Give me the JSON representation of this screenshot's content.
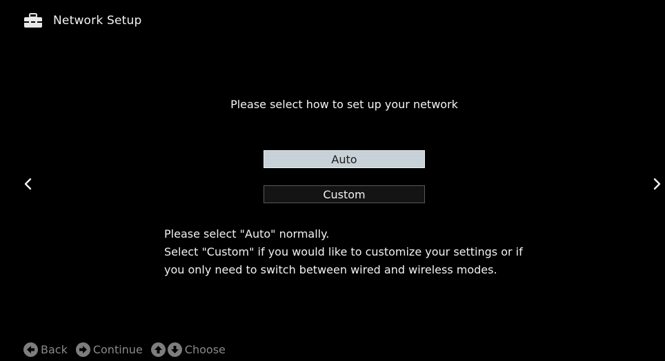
{
  "header": {
    "icon": "toolbox-icon",
    "title": "Network Setup"
  },
  "main": {
    "prompt": "Please select how to set up your network",
    "options": [
      {
        "label": "Auto",
        "selected": true
      },
      {
        "label": "Custom",
        "selected": false
      }
    ],
    "help_lines": [
      "Please select \"Auto\" normally.",
      "Select \"Custom\" if you would like to customize your settings or if",
      "you only need to switch between wired and wireless modes."
    ]
  },
  "navigation": {
    "left_icon": "chevron-left-icon",
    "right_icon": "chevron-right-icon"
  },
  "footer": {
    "back_label": "Back",
    "continue_label": "Continue",
    "choose_label": "Choose"
  },
  "colors": {
    "background": "#000000",
    "selected_option": "#c9d3da",
    "text": "#f2f2f2",
    "footer_text": "#8a8a8a"
  }
}
